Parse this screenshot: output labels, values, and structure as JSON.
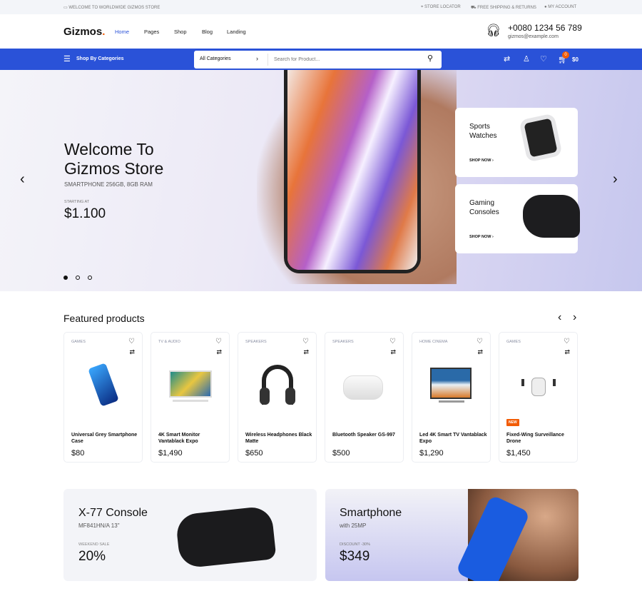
{
  "topbar": {
    "welcome": "WELCOME TO WORLDWIDE GIZMOS STORE",
    "store_locator": "STORE LOCATOR",
    "shipping": "FREE SHIPPING & RETURNS",
    "account": "MY ACCOUNT"
  },
  "header": {
    "logo": "Gizmos",
    "logo_dot": ".",
    "nav": [
      "Home",
      "Pages",
      "Shop",
      "Blog",
      "Landing"
    ],
    "phone": "+0080 1234 56 789",
    "email": "gizmos@example.com"
  },
  "bluebar": {
    "categories_label": "Shop By Categories",
    "category_select": "All Categories",
    "search_placeholder": "Search for Product...",
    "cart_count": "0",
    "cart_total": "$0"
  },
  "hero": {
    "title_line1": "Welcome To",
    "title_line2": "Gizmos Store",
    "subtitle": "SMARTPHONE 256GB, 8GB RAM",
    "starting_label": "STARTING AT",
    "price": "$1.100",
    "active_slide": 1,
    "slides": 3
  },
  "promos": [
    {
      "title": "Sports Watches",
      "cta": "SHOP NOW"
    },
    {
      "title": "Gaming Consoles",
      "cta": "SHOP NOW"
    }
  ],
  "featured": {
    "title": "Featured products",
    "products": [
      {
        "category": "GAMES",
        "name": "Universal Grey Smartphone Case",
        "price": "$80"
      },
      {
        "category": "TV & AUDIO",
        "name": "4K Smart Monitor Vantablack Expo",
        "price": "$1,490"
      },
      {
        "category": "SPEAKERS",
        "name": "Wireless Headphones Black Matte",
        "price": "$650"
      },
      {
        "category": "SPEAKERS",
        "name": "Bluetooth Speaker GS-997",
        "price": "$500"
      },
      {
        "category": "HOME CINEMA",
        "name": "Led 4K Smart TV Vantablack Expo",
        "price": "$1,290"
      },
      {
        "category": "GAMES",
        "name": "Fixed-Wing Surveillance Drone",
        "price": "$1,450",
        "badge": "NEW"
      }
    ]
  },
  "banners": [
    {
      "title": "X-77 Console",
      "subtitle": "MF841HN/A 13\"",
      "label": "WEEKEND SALE",
      "value": "20%"
    },
    {
      "title": "Smartphone",
      "subtitle": "with 25MP",
      "label": "DISCOUNT -30%",
      "value": "$349"
    }
  ],
  "colors": {
    "brand": "#2a52d8",
    "accent": "#f25c05"
  }
}
